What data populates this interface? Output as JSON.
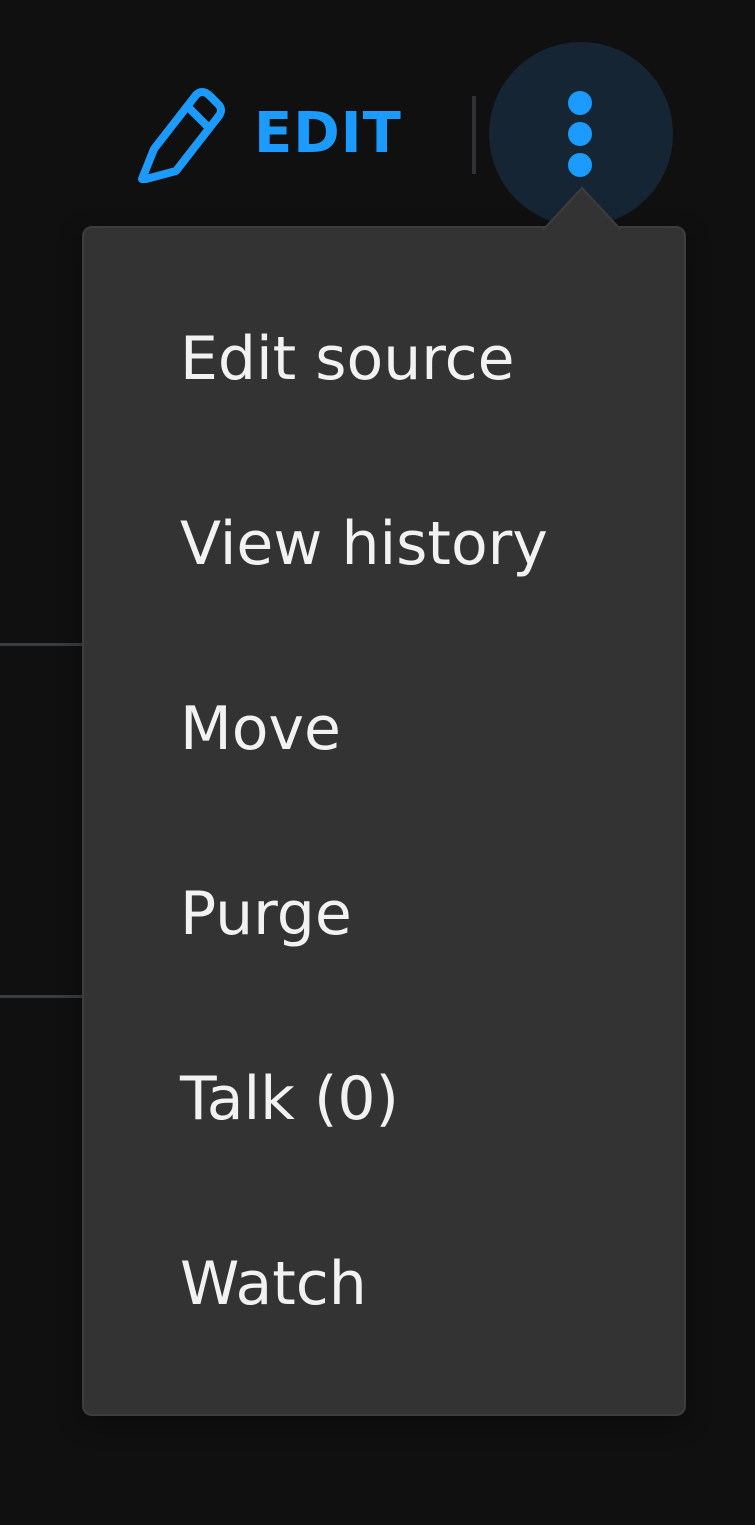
{
  "toolbar": {
    "edit_label": "EDIT",
    "edit_icon": "pencil-icon",
    "more_icon": "more-vertical-icon",
    "accent_color": "#1b9bff"
  },
  "menu": {
    "items": [
      {
        "label": "Edit source"
      },
      {
        "label": "View history"
      },
      {
        "label": "Move"
      },
      {
        "label": "Purge"
      },
      {
        "label": "Talk (0)"
      },
      {
        "label": "Watch"
      }
    ]
  }
}
